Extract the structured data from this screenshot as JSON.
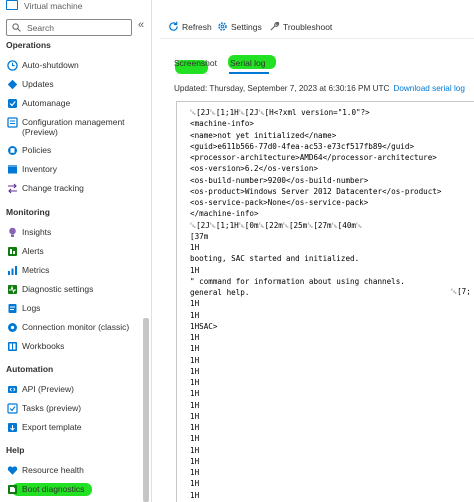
{
  "sidebar": {
    "title": "Virtual machine",
    "search_placeholder": "Search",
    "collapse_glyph": "«",
    "sections": {
      "operations": "Operations",
      "monitoring": "Monitoring",
      "automation": "Automation",
      "help": "Help"
    },
    "items": [
      {
        "label": "Auto-shutdown",
        "icon": "clock-icon",
        "color": "#0078d4"
      },
      {
        "label": "Updates",
        "icon": "updates-icon",
        "color": "#0078d4"
      },
      {
        "label": "Automanage",
        "icon": "automanage-icon",
        "color": "#0078d4"
      },
      {
        "label": "Configuration management",
        "label2": "(Preview)",
        "icon": "config-icon",
        "color": "#0078d4"
      },
      {
        "label": "Policies",
        "icon": "policy-icon",
        "color": "#0078d4"
      },
      {
        "label": "Inventory",
        "icon": "inventory-icon",
        "color": "#0078d4"
      },
      {
        "label": "Change tracking",
        "icon": "change-tracking-icon",
        "color": "#5c2d91"
      },
      {
        "label": "Insights",
        "icon": "insights-icon",
        "color": "#8764b8"
      },
      {
        "label": "Alerts",
        "icon": "alerts-icon",
        "color": "#107c10"
      },
      {
        "label": "Metrics",
        "icon": "metrics-icon",
        "color": "#0078d4"
      },
      {
        "label": "Diagnostic settings",
        "icon": "diagnostic-icon",
        "color": "#107c10"
      },
      {
        "label": "Logs",
        "icon": "logs-icon",
        "color": "#0078d4"
      },
      {
        "label": "Connection monitor (classic)",
        "icon": "connection-monitor-icon",
        "color": "#0078d4"
      },
      {
        "label": "Workbooks",
        "icon": "workbooks-icon",
        "color": "#0078d4"
      },
      {
        "label": "API (Preview)",
        "icon": "api-icon",
        "color": "#0078d4"
      },
      {
        "label": "Tasks (preview)",
        "icon": "tasks-icon",
        "color": "#0078d4"
      },
      {
        "label": "Export template",
        "icon": "export-icon",
        "color": "#0078d4"
      },
      {
        "label": "Resource health",
        "icon": "heart-icon",
        "color": "#0078d4"
      },
      {
        "label": "Boot diagnostics",
        "icon": "boot-diagnostics-icon",
        "color": "#107c10"
      }
    ]
  },
  "toolbar": {
    "refresh": "Refresh",
    "settings": "Settings",
    "troubleshoot": "Troubleshoot"
  },
  "tabs": {
    "screenshot": "Screenshot",
    "serial_log": "Serial log",
    "active": "Serial log"
  },
  "updated": {
    "text": "Updated: Thursday, September 7, 2023 at 6:30:16 PM UTC",
    "download": "Download serial log"
  },
  "log": {
    "lines": [
      "\u001b[2J\u001b[1;1H\u001b[2J\u001b[H<?xml version=\"1.0\"?>",
      "<machine-info>",
      "<name>not yet initialized</name>",
      "<guid>e611b566-77d0-4fea-ac53-e73cf517fb89</guid>",
      "<processor-architecture>AMD64</processor-architecture>",
      "<os-version>6.2</os-version>",
      "<os-build-number>9200</os-build-number>",
      "<os-product>Windows Server 2012 Datacenter</os-product>",
      "<os-service-pack>None</os-service-pack>",
      "</machine-info>",
      "\u001b[2J\u001b[1;1H\u001b[0m\u001b[22m\u001b[25m\u001b[27m\u001b[40m\u001b",
      "[37m",
      "1H",
      "booting, SAC started and initialized.",
      "1H",
      "\" command for information about using channels.",
      "general help.",
      "1H",
      "1H",
      "1HSAC>",
      "1H",
      "1H",
      "1H",
      "1H",
      "1H",
      "1H",
      "1H",
      "1H",
      "1H",
      "1H",
      "1H",
      "1H",
      "1H",
      "1H",
      "1H",
      "1H"
    ],
    "trailing_fragment": "\u001b[7;"
  },
  "colors": {
    "accent": "#0078d4",
    "highlight": "#22e022"
  }
}
